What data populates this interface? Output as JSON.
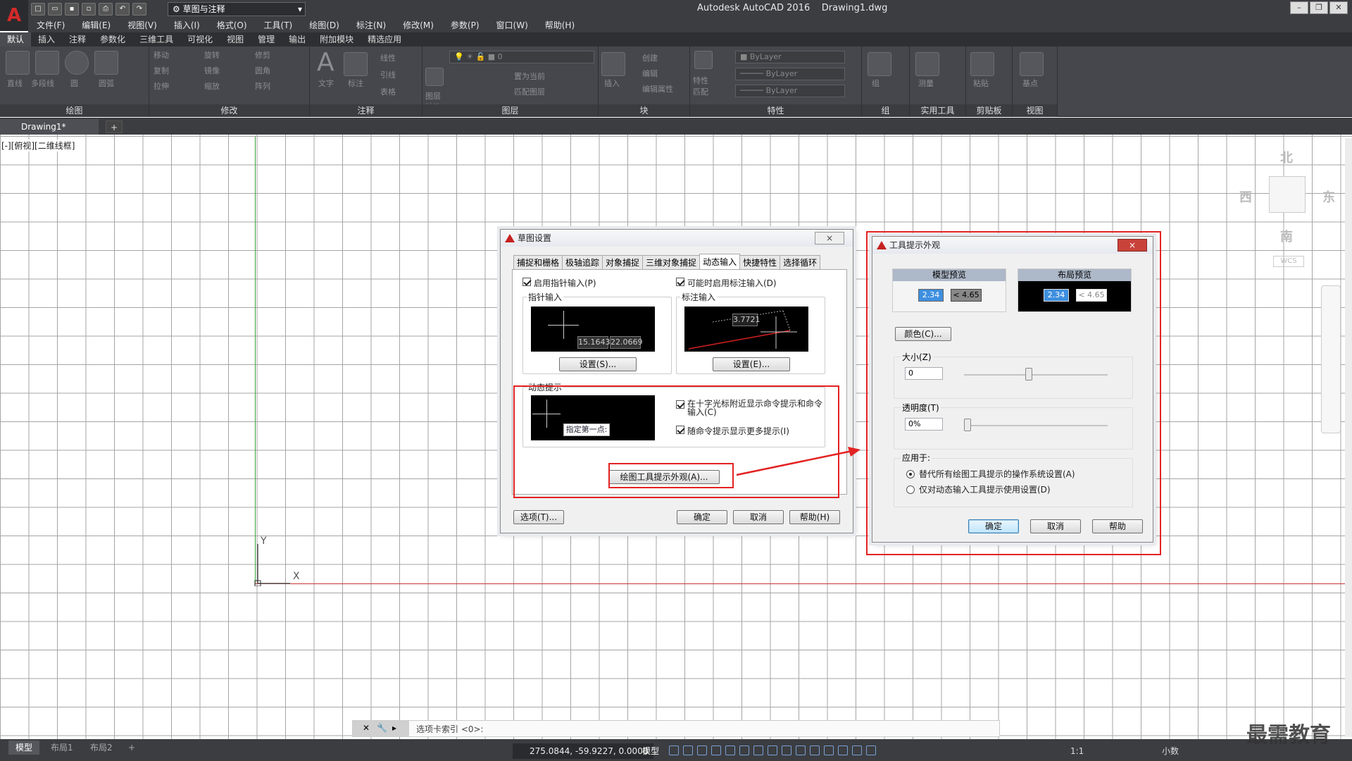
{
  "titlebar": {
    "app_title": "Autodesk AutoCAD 2016    Drawing1.dwg",
    "workspace": "草图与注释",
    "logo": "A"
  },
  "menu": [
    "文件(F)",
    "编辑(E)",
    "视图(V)",
    "插入(I)",
    "格式(O)",
    "工具(T)",
    "绘图(D)",
    "标注(N)",
    "修改(M)",
    "参数(P)",
    "窗口(W)",
    "帮助(H)"
  ],
  "ribbon_tabs": [
    "默认",
    "插入",
    "注释",
    "参数化",
    "三维工具",
    "可视化",
    "视图",
    "管理",
    "输出",
    "附加模块",
    "精选应用"
  ],
  "ribbon": {
    "draw_tools": [
      "直线",
      "多段线",
      "圆",
      "圆弧"
    ],
    "modify_tools": [
      "移动",
      "旋转",
      "修剪",
      "复制",
      "镜像",
      "圆角",
      "拉伸",
      "缩放",
      "阵列"
    ],
    "annot_tools": [
      "文字",
      "标注",
      "线性",
      "引线",
      "表格"
    ],
    "layer_tools": [
      "图层特性",
      "置为当前",
      "匹配图层"
    ],
    "layer_value": "0",
    "block_tools": [
      "插入",
      "创建",
      "编辑",
      "编辑属性"
    ],
    "prop_combos": [
      "ByLayer",
      "ByLayer",
      "ByLayer"
    ],
    "prop_labels": [
      "特性匹配"
    ],
    "group_tools": [
      "组"
    ],
    "util_tools": [
      "测量"
    ],
    "clip_tools": [
      "粘贴"
    ],
    "view_tools": [
      "基点"
    ],
    "panels": [
      "绘图",
      "修改",
      "注释",
      "图层",
      "块",
      "特性",
      "组",
      "实用工具",
      "剪贴板",
      "视图"
    ]
  },
  "doc_tab": "Drawing1*",
  "viewport_label": "[-][俯视][二维线框]",
  "viewcube": {
    "n": "北",
    "s": "南",
    "e": "东",
    "w": "西",
    "wcs": "WCS"
  },
  "ucs": {
    "x": "X",
    "y": "Y"
  },
  "command_line": "选项卡索引 <0>:",
  "layout_tabs": [
    "模型",
    "布局1",
    "布局2"
  ],
  "status": {
    "coords": "275.0844, -59.9227, 0.0000",
    "model": "模型",
    "scale": "1:1",
    "decimal": "小数"
  },
  "watermark": "最需教育",
  "drafting_dialog": {
    "title": "草图设置",
    "close": "×",
    "tabs": [
      "捕捉和栅格",
      "极轴追踪",
      "对象捕捉",
      "三维对象捕捉",
      "动态输入",
      "快捷特性",
      "选择循环"
    ],
    "active_tab": 4,
    "pointer_input": {
      "enable_label": "启用指针输入(P)",
      "group": "指针输入",
      "preview_values": [
        "15.1643",
        "22.0669"
      ],
      "settings": "设置(S)..."
    },
    "dim_input": {
      "enable_label": "可能时启用标注输入(D)",
      "group": "标注输入",
      "preview_value": "3.7721",
      "settings": "设置(E)..."
    },
    "dyn_prompt": {
      "group": "动态提示",
      "preview_text": "指定第一点:",
      "chk1": "在十字光标附近显示命令提示和命令输入(C)",
      "chk2": "随命令提示显示更多提示(I)",
      "appearance_button": "绘图工具提示外观(A)..."
    },
    "buttons": {
      "options": "选项(T)...",
      "ok": "确定",
      "cancel": "取消",
      "help": "帮助(H)"
    }
  },
  "tooltip_dialog": {
    "title": "工具提示外观",
    "close": "×",
    "model_preview": {
      "label": "模型预览",
      "v1": "2.34",
      "v2": "< 4.65"
    },
    "layout_preview": {
      "label": "布局预览",
      "v1": "2.34",
      "v2": "< 4.65"
    },
    "color_button": "颜色(C)...",
    "size": {
      "label": "大小(Z)",
      "value": "0",
      "level": 0.45
    },
    "transparency": {
      "label": "透明度(T)",
      "value": "0%",
      "level": 0.0
    },
    "apply_to": {
      "label": "应用于:",
      "opt1": "替代所有绘图工具提示的操作系统设置(A)",
      "opt2": "仅对动态输入工具提示使用设置(D)",
      "selected": 1
    },
    "buttons": {
      "ok": "确定",
      "cancel": "取消",
      "help": "帮助"
    }
  },
  "colors": {
    "highlight": "#e32222",
    "accent_red": "#c62020"
  }
}
